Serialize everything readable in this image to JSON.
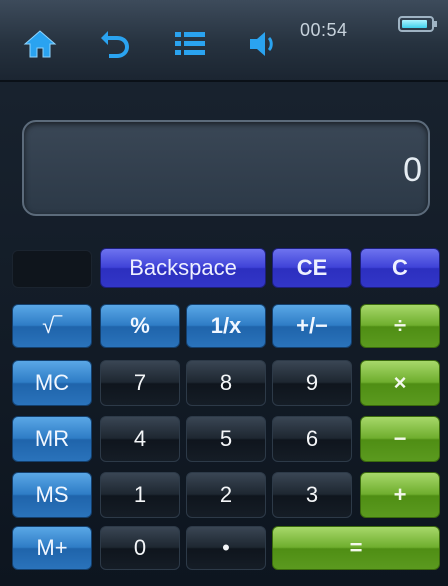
{
  "status_bar": {
    "time": "00:54",
    "battery_level": 0.9,
    "icons": [
      "home-icon",
      "back-icon",
      "menu-list-icon",
      "volume-icon"
    ]
  },
  "display": {
    "value": "0"
  },
  "keys": {
    "backspace": "Backspace",
    "ce": "CE",
    "c": "C",
    "sqrt": "√‾",
    "percent": "%",
    "reciprocal": "1/x",
    "plus_minus": "+/−",
    "divide": "÷",
    "mc": "MC",
    "mr": "MR",
    "ms": "MS",
    "mplus": "M+",
    "n7": "7",
    "n8": "8",
    "n9": "9",
    "n4": "4",
    "n5": "5",
    "n6": "6",
    "n1": "1",
    "n2": "2",
    "n3": "3",
    "n0": "0",
    "decimal": "•",
    "multiply": "×",
    "minus": "−",
    "plus": "+",
    "equals": "="
  },
  "colors": {
    "memory_key": "#2f7dc6",
    "operator_key": "#6fae2e",
    "clear_key": "#3f43d8",
    "number_key": "#1e2731",
    "battery": "#3fd0ec"
  }
}
